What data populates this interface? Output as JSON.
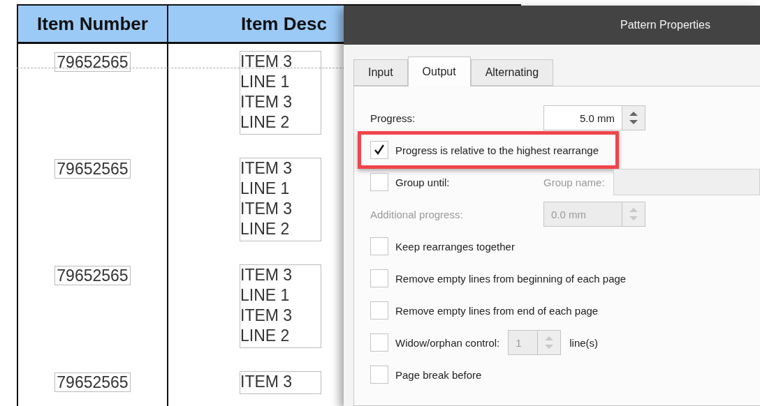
{
  "table": {
    "columns": [
      "Item Number",
      "Item Desc"
    ],
    "rows": [
      {
        "item_number": "79652565",
        "description": [
          "ITEM 3",
          "LINE 1",
          "ITEM 3",
          "LINE 2"
        ]
      },
      {
        "item_number": "79652565",
        "description": [
          "ITEM 3",
          "LINE 1",
          "ITEM 3",
          "LINE 2"
        ]
      },
      {
        "item_number": "79652565",
        "description": [
          "ITEM 3",
          "LINE 1",
          "ITEM 3",
          "LINE 2"
        ]
      },
      {
        "item_number": "79652565",
        "description": [
          "ITEM 3"
        ]
      }
    ]
  },
  "dialog": {
    "title": "Pattern Properties",
    "tabs": [
      {
        "label": "Input",
        "selected": false
      },
      {
        "label": "Output",
        "selected": true
      },
      {
        "label": "Alternating",
        "selected": false
      }
    ],
    "options": [
      {
        "kind": "spin",
        "label": "Progress:",
        "value": "5.0 mm",
        "disabled": false
      },
      {
        "kind": "check",
        "label": "Progress is relative to the highest rearrange",
        "checked": true,
        "highlighted": true
      },
      {
        "kind": "group",
        "label": "Group until:",
        "checked": false,
        "field_label": "Group name:"
      },
      {
        "kind": "spin",
        "label": "Additional progress:",
        "value": "0.0 mm",
        "disabled": true
      },
      {
        "kind": "check",
        "label": "Keep rearranges together",
        "checked": false,
        "highlighted": false
      },
      {
        "kind": "check",
        "label": "Remove empty lines from beginning of each page",
        "checked": false,
        "highlighted": false
      },
      {
        "kind": "check",
        "label": "Remove empty lines from end of each page",
        "checked": false,
        "highlighted": false
      },
      {
        "kind": "check_spin",
        "label": "Widow/orphan control:",
        "checked": false,
        "value": "1",
        "suffix": "line(s)"
      },
      {
        "kind": "check",
        "label": "Page break before",
        "checked": false,
        "highlighted": false
      }
    ]
  }
}
